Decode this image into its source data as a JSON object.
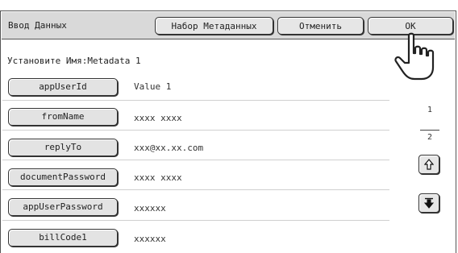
{
  "header": {
    "title": "Ввод Данных",
    "metadata_button": "Набор Метаданных",
    "cancel_button": "Отменить",
    "ok_button": "OK"
  },
  "instruction": "Установите Имя:Metadata 1",
  "fields": [
    {
      "label": "appUserId",
      "value": "Value 1"
    },
    {
      "label": "fromName",
      "value": "xxxx xxxx"
    },
    {
      "label": "replyTo",
      "value": "xxx@xx.xx.com"
    },
    {
      "label": "documentPassword",
      "value": "xxxx xxxx"
    },
    {
      "label": "appUserPassword",
      "value": "xxxxxx"
    },
    {
      "label": "billCode1",
      "value": "xxxxxx"
    }
  ],
  "pager": {
    "current": "1",
    "total": "2"
  },
  "icons": {
    "scroll_up": "arrow-up-icon",
    "scroll_down": "arrow-down-icon",
    "pointer": "pointing-hand-icon"
  },
  "colors": {
    "titlebar": "#d9d9d9",
    "button": "#e3e3e3",
    "border": "#333333"
  }
}
